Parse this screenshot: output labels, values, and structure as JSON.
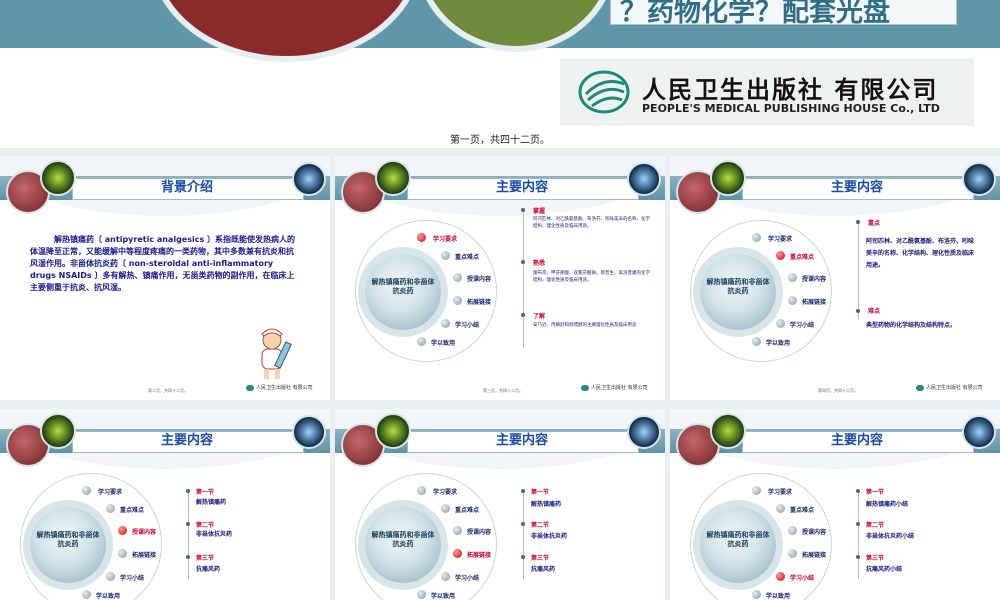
{
  "header": {
    "title": "？药物化学？配套光盘",
    "publisher_cn": "人民卫生出版社 有限公司",
    "publisher_en": "PEOPLE'S MEDICAL PUBLISHING HOUSE Co., LTD",
    "page_caption": "第一页，共四十二页。"
  },
  "slides": [
    {
      "title": "背景介绍",
      "body": "解热镇痛药〔 antipyretic analgesics 〕系指既能使发热病人的体温降至正常，又能缓解中等程度疼痛的一类药物，其中多数兼有抗炎和抗风湿作用。非甾体抗炎药〔 non-steroidal anti-inflammatory drugs NSAIDs 〕多有解热、镇痛作用，无甾类药物的副作用，在临床上主要侧重于抗炎、抗风湿。",
      "footer": "第二页，共四十二页。"
    },
    {
      "title": "主要内容",
      "center": "解热镇痛药和非甾体抗炎药",
      "menu": [
        "学习要求",
        "重点难点",
        "授课内容",
        "拓展链接",
        "学习小结",
        "学以致用"
      ],
      "active": 0,
      "right": [
        {
          "head": "掌握",
          "text": "阿司匹林、对乙酰氨基酚、布洛芬、吲哚美辛的名称、化学结构、理化性质及临床用途。"
        },
        {
          "head": "熟悉",
          "text": "羧布宗、甲芬那酸、双氯芬酸钠、萘普生、美洛昔康的化学结构、理化性质及临床用途。"
        },
        {
          "head": "了解",
          "text": "安乃近、丙磺舒和别嘌醇的主要理化性质及临床用途"
        }
      ],
      "footer": "第三页，共四十二页。"
    },
    {
      "title": "主要内容",
      "center": "解热镇痛药和非甾体抗炎药",
      "menu": [
        "学习要求",
        "重点难点",
        "授课内容",
        "拓展链接",
        "学习小结",
        "学以致用"
      ],
      "active": 1,
      "right": [
        {
          "head": "重点",
          "text": "阿司匹林、对乙酰氨基酚、布洛芬、吲哚美辛的名称、化学结构、理化性质及临床用途。"
        },
        {
          "head": "难点",
          "text": "典型药物的化学结构及结构特点。"
        }
      ],
      "footer": "第四页，共四十二页。"
    },
    {
      "title": "主要内容",
      "center": "解热镇痛药和非甾体抗炎药",
      "menu": [
        "学习要求",
        "重点难点",
        "授课内容",
        "拓展链接",
        "学习小结",
        "学以致用"
      ],
      "active": 2,
      "right": [
        {
          "head": "第一节",
          "text": "解热镇痛药"
        },
        {
          "head": "第二节",
          "text": "非甾体抗炎药"
        },
        {
          "head": "第三节",
          "text": "抗痛风药"
        }
      ]
    },
    {
      "title": "主要内容",
      "center": "解热镇痛药和非甾体抗炎药",
      "menu": [
        "学习要求",
        "重点难点",
        "授课内容",
        "拓展链接",
        "学习小结",
        "学以致用"
      ],
      "active": 3,
      "right": [
        {
          "head": "第一节",
          "text": "解热镇痛药"
        },
        {
          "head": "第二节",
          "text": "非甾体抗炎药"
        },
        {
          "head": "第三节",
          "text": "抗痛风药"
        }
      ]
    },
    {
      "title": "主要内容",
      "center": "解热镇痛药和非甾体抗炎药",
      "menu": [
        "学习要求",
        "重点难点",
        "授课内容",
        "拓展链接",
        "学习小结",
        "学以致用"
      ],
      "active": 4,
      "right": [
        {
          "head": "第一节",
          "text": "解热镇痛药小结"
        },
        {
          "head": "第二节",
          "text": "非甾体抗炎药小结"
        },
        {
          "head": "第三节",
          "text": "抗痛风药小结"
        }
      ]
    }
  ],
  "footer_logo": "人民卫生出版社 有限公司",
  "colors": {
    "band": "#6f9fb1",
    "title": "#1a4aa8",
    "active": "#cc0033",
    "body_text": "#1b1b8c"
  },
  "icons": [
    "publisher-logo-icon",
    "nurse-illustration",
    "red-cell-icon",
    "green-bacteria-icon",
    "blue-cell-icon"
  ]
}
